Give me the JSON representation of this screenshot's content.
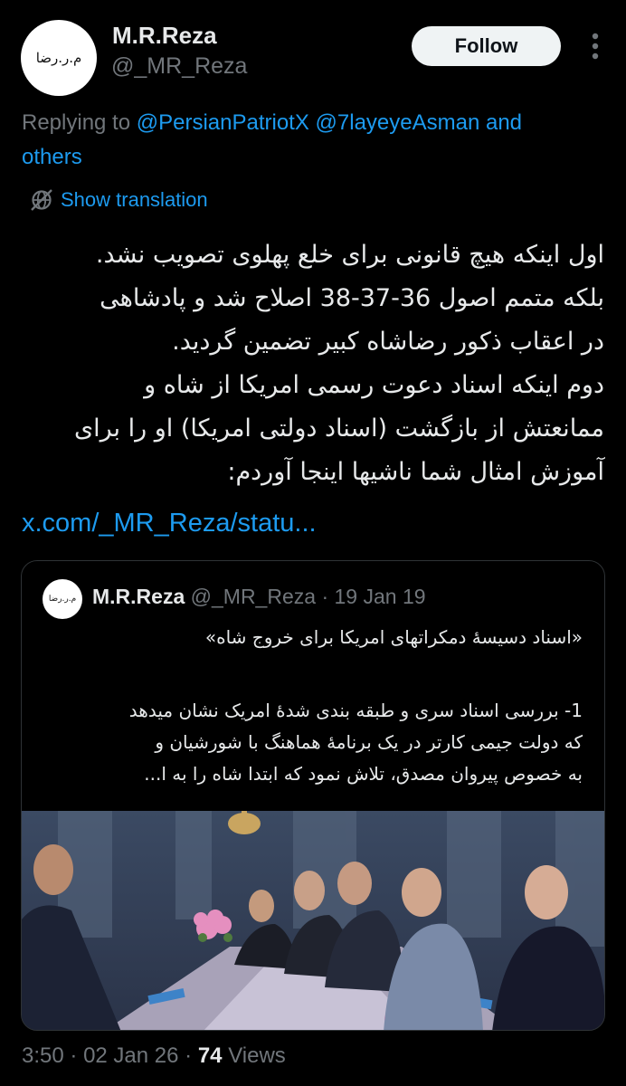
{
  "author": {
    "avatar_text": "م.ر.رضا",
    "name": "M.R.Reza",
    "handle": "@_MR_Reza"
  },
  "actions": {
    "follow_label": "Follow"
  },
  "reply": {
    "prefix": "Replying to ",
    "mention1": "@PersianPatriotX",
    "mention2": "@7layeyeAsman",
    "and_word": "and",
    "others": "others"
  },
  "translation": {
    "label": "Show translation"
  },
  "tweet": {
    "lines": [
      "اول اینکه هیچ قانونی برای خلع پهلوی تصویب نشد.",
      "بلکه متمم اصول 36-37-38 اصلاح شد و پادشاهی",
      "در اعقاب ذکور رضاشاه کبیر تضمین گردید.",
      "دوم اینکه اسناد دعوت رسمی امریکا از شاه و",
      "ممانعتش از بازگشت (اسناد دولتی امریکا) او را برای",
      "آموزش امثال شما ناشیها اینجا آوردم:"
    ],
    "link": "x.com/_MR_Reza/statu..."
  },
  "quote": {
    "avatar_text": "م.ر.رضا",
    "name": "M.R.Reza",
    "handle": "@_MR_Reza",
    "separator": "·",
    "date": "19 Jan 19",
    "title": "«اسناد دسیسهٔ دمکراتهای امریکا برای خروج شاه»",
    "body_lines": [
      "1- بررسی اسناد سری و طبقه بندی شدهٔ امریک نشان میدهد",
      "که دولت جیمی کارتر در یک برنامهٔ هماهنگ با شورشیان و",
      "به خصوص پیروان مصدق، تلاش نمود که ابتدا شاه را به ا..."
    ]
  },
  "footer": {
    "time": "3:50",
    "separator": "·",
    "date": "02 Jan 26",
    "views_count": "74",
    "views_label": "Views"
  },
  "colors": {
    "background": "#000000",
    "text": "#e7e9ea",
    "muted": "#71767b",
    "link": "#1d9bf0",
    "border": "#2f3336",
    "follow_bg": "#eff3f4"
  },
  "icons": {
    "more": "more-dots-icon",
    "translate": "translate-globe-icon"
  }
}
